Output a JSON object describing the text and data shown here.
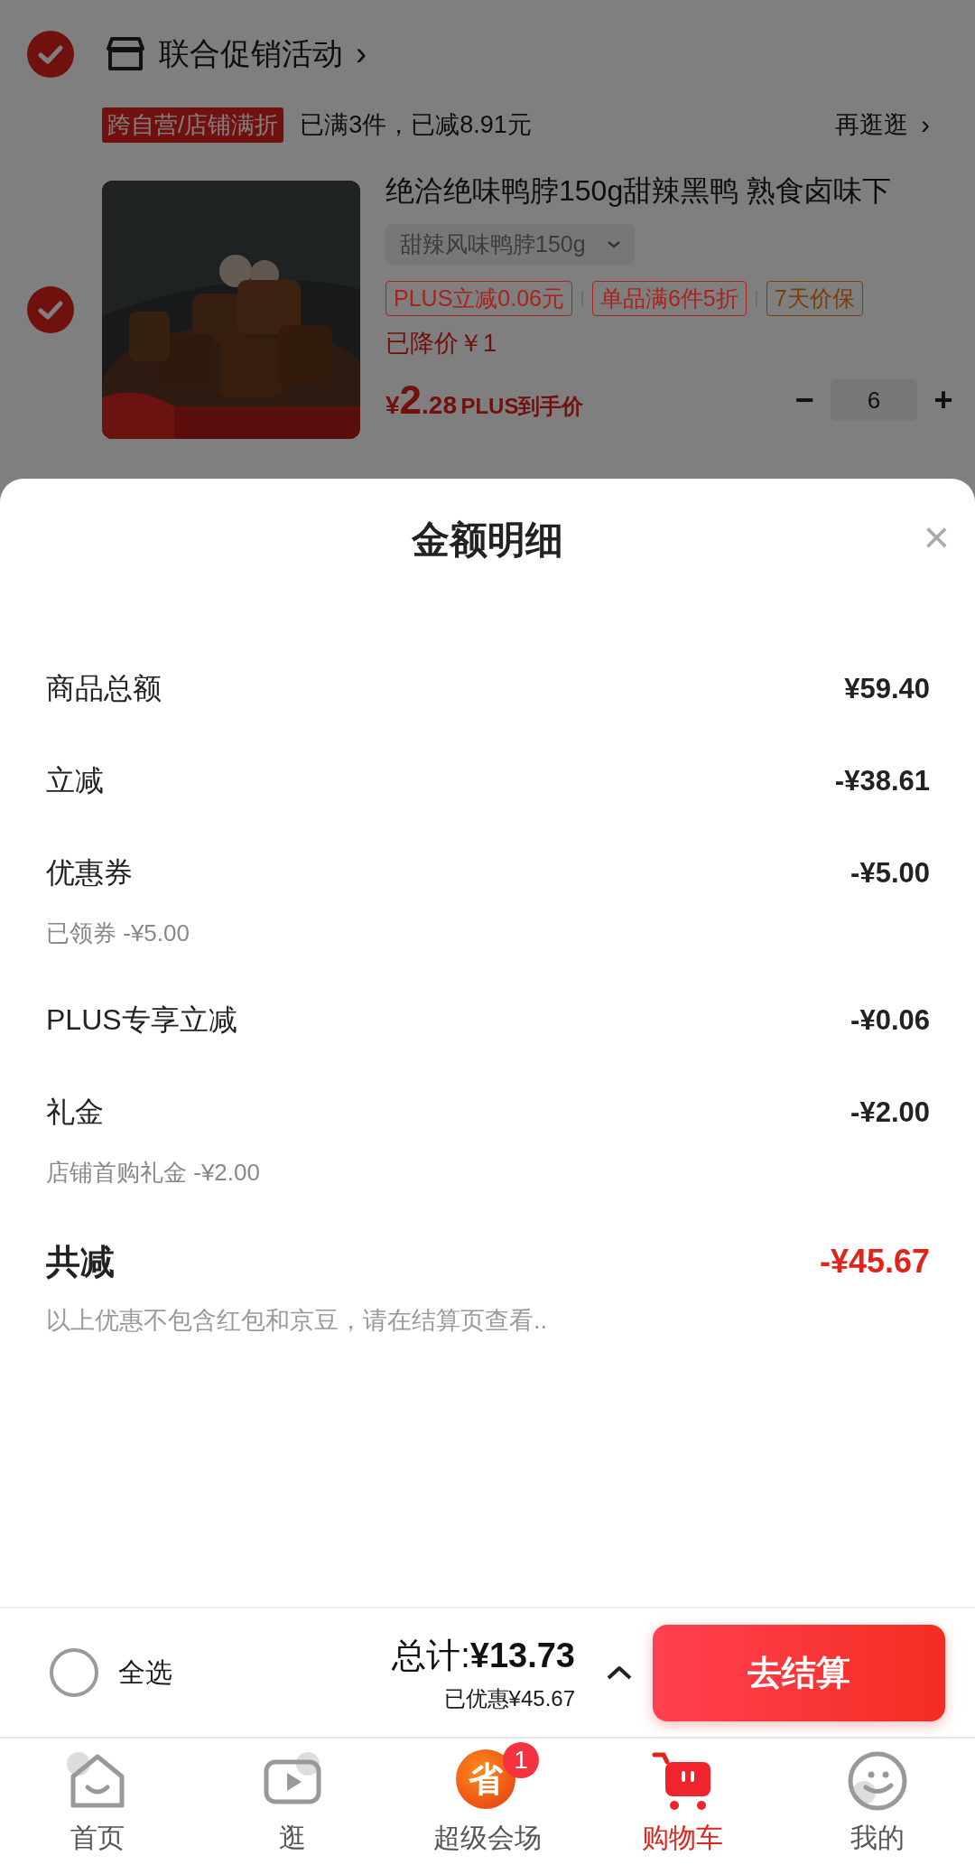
{
  "store_group": {
    "checked": true,
    "title": "联合促销活动",
    "chevron": "›",
    "promo_tag": "跨自营/店铺满折",
    "promo_text": "已满3件，已减8.91元",
    "more_link": "再逛逛",
    "more_chevron": "›"
  },
  "product": {
    "checked": true,
    "kind": "picture",
    "title": "绝洽绝味鸭脖150g甜辣黑鸭 熟食卤味下",
    "variant": "甜辣风味鸭脖150g",
    "tags": [
      {
        "text": "PLUS立减0.06元",
        "color": "#a8231c"
      },
      {
        "text": "单品满6件5折",
        "color": "#a8231c"
      },
      {
        "text": "7天价保",
        "color": "#7a3f05"
      }
    ],
    "price_drop": "已降价￥1",
    "price_symbol": "¥",
    "price_int": "2",
    "price_dec": ".28",
    "price_note": "PLUS到手价",
    "minus": "−",
    "quantity": "6",
    "plus": "+"
  },
  "sheet": {
    "title": "金额明细",
    "close": "×",
    "rows": [
      {
        "label": "商品总额",
        "amount": "¥59.40"
      },
      {
        "label": "立减",
        "amount": "-¥38.61"
      },
      {
        "label": "优惠券",
        "amount": "-¥5.00",
        "note": "已领券 -¥5.00"
      },
      {
        "label": "PLUS专享立减",
        "amount": "-¥0.06"
      },
      {
        "label": "礼金",
        "amount": "-¥2.00",
        "note": "店铺首购礼金 -¥2.00"
      }
    ],
    "total": {
      "label": "共减",
      "amount": "-¥45.67"
    },
    "disclaimer": "以上优惠不包含红包和京豆，请在结算页查看.."
  },
  "checkout_bar": {
    "select_all": {
      "checked": false,
      "label": "全选"
    },
    "total_label": "总计:",
    "total_amount": "¥13.73",
    "saved": "已优惠¥45.67",
    "checkout_button": "去结算"
  },
  "tab_bar": [
    {
      "kind": "home",
      "label": "首页",
      "selected": false
    },
    {
      "kind": "video",
      "label": "逛",
      "selected": false
    },
    {
      "kind": "promo",
      "label": "超级会场",
      "selected": false,
      "glyph": "省",
      "badge": "1"
    },
    {
      "kind": "cart",
      "label": "购物车",
      "selected": true
    },
    {
      "kind": "profile",
      "label": "我的",
      "selected": false
    }
  ]
}
